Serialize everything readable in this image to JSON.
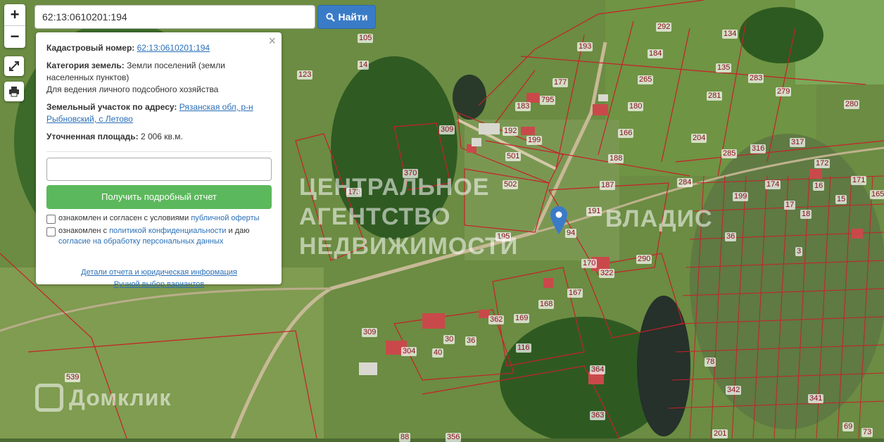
{
  "search": {
    "value": "62:13:0610201:194",
    "button_label": "Найти"
  },
  "zoom": {
    "in_label": "+",
    "out_label": "−"
  },
  "panel": {
    "cadastral_label": "Кадастровый номер:",
    "cadastral_value": "62:13:0610201:194",
    "category_label": "Категория земель:",
    "category_value": "Земли поселений (земли населенных пунктов)",
    "category_use": "Для ведения личного подсобного хозяйства",
    "address_label": "Земельный участок по адресу:",
    "address_value": "Рязанская обл, р-н Рыбновский, с Летово",
    "area_label": "Уточненная площадь:",
    "area_value": "2 006 кв.м.",
    "phone_value": "",
    "report_button": "Получить подробный отчет",
    "consent1_text": "ознакомлен и согласен с условиями",
    "consent1_link": "публичной оферты",
    "consent2_text": "ознакомлен с",
    "consent2_link": "политикой конфиденциальности",
    "consent2_mid": "и даю",
    "consent2_link2": "согласие на обработку персональных данных",
    "details_link": "Детали отчета и юридическая информация",
    "manual_link": "Ручной выбор вариантов",
    "close": "×"
  },
  "watermarks": {
    "agency_line1": "ЦЕНТРАЛЬНОЕ",
    "agency_line2": "АГЕНТСТВО",
    "agency_line3": "НЕДВИЖИМОСТИ",
    "vladis": "ВЛАДИС",
    "domclick": "Домклик"
  },
  "parcels": [
    "292",
    "134",
    "193",
    "184",
    "265",
    "135",
    "283",
    "279",
    "280",
    "105",
    "14",
    "123",
    "177",
    "183",
    "795",
    "180",
    "281",
    "166",
    "192",
    "199",
    "501",
    "188",
    "204",
    "285",
    "316",
    "317",
    "309",
    "370",
    "173",
    "502",
    "187",
    "284",
    "172",
    "16",
    "171",
    "165",
    "174",
    "199",
    "17",
    "15",
    "191",
    "94",
    "195",
    "290",
    "36",
    "18",
    "3",
    "170",
    "322",
    "167",
    "168",
    "169",
    "362",
    "116",
    "36",
    "30",
    "40",
    "304",
    "309",
    "364",
    "539",
    "363",
    "342",
    "341",
    "78",
    "201",
    "73",
    "69",
    "356",
    "88"
  ],
  "colors": {
    "parcel_line": "#c8202a",
    "accent": "#3a7bc8",
    "success": "#5cb85c"
  }
}
